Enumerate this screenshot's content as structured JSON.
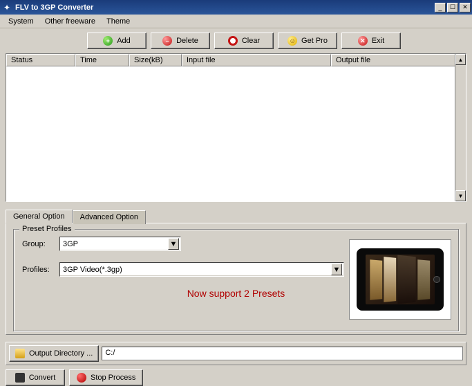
{
  "window": {
    "title": "FLV to 3GP Converter"
  },
  "menu": {
    "system": "System",
    "other_freeware": "Other freeware",
    "theme": "Theme"
  },
  "toolbar": {
    "add": "Add",
    "delete": "Delete",
    "clear": "Clear",
    "getpro": "Get Pro",
    "exit": "Exit"
  },
  "columns": {
    "status": "Status",
    "time": "Time",
    "size": "Size(kB)",
    "input": "Input file",
    "output": "Output file"
  },
  "tabs": {
    "general": "General Option",
    "advanced": "Advanced Option"
  },
  "preset": {
    "legend": "Preset Profiles",
    "group_label": "Group:",
    "group_value": "3GP",
    "profiles_label": "Profiles:",
    "profiles_value": "3GP Video(*.3gp)",
    "support_msg": "Now support 2 Presets"
  },
  "output": {
    "button": "Output Directory ...",
    "path": "C:/"
  },
  "actions": {
    "convert": "Convert",
    "stop": "Stop Process"
  }
}
